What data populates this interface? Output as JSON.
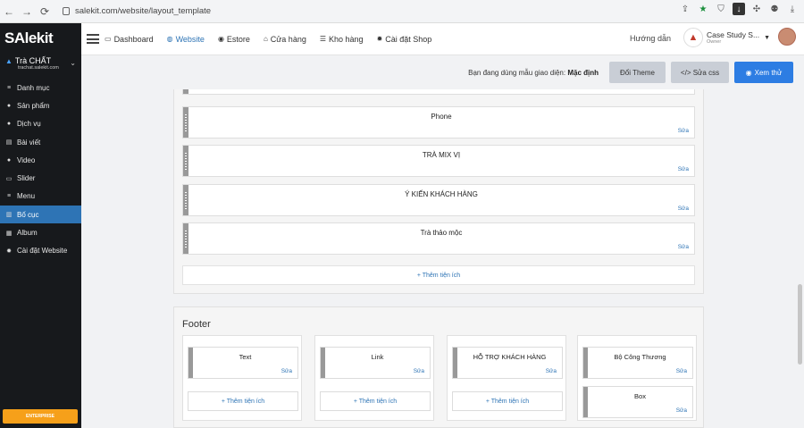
{
  "browser": {
    "url": "salekit.com/website/layout_template"
  },
  "sidebar": {
    "logo": "SAlekit",
    "shop_name": "Trà CHẤT",
    "shop_domain": "trachat.salekit.com",
    "items": [
      {
        "label": "Danh mục",
        "icon": "list-icon"
      },
      {
        "label": "Sản phẩm",
        "icon": "product-icon"
      },
      {
        "label": "Dịch vụ",
        "icon": "service-icon"
      },
      {
        "label": "Bài viết",
        "icon": "article-icon"
      },
      {
        "label": "Video",
        "icon": "video-icon"
      },
      {
        "label": "Slider",
        "icon": "slider-icon"
      },
      {
        "label": "Menu",
        "icon": "menu-icon"
      },
      {
        "label": "Bố cục",
        "icon": "layout-icon",
        "active": true
      },
      {
        "label": "Album",
        "icon": "album-icon"
      },
      {
        "label": "Cài đặt Website",
        "icon": "gear-icon"
      }
    ],
    "upgrade_label": "ENTERPRISE"
  },
  "topnav": {
    "items": [
      {
        "label": "Dashboard",
        "icon": "monitor-icon"
      },
      {
        "label": "Website",
        "icon": "globe-icon",
        "active": true
      },
      {
        "label": "Estore",
        "icon": "compass-icon"
      },
      {
        "label": "Cửa hàng",
        "icon": "store-icon"
      },
      {
        "label": "Kho hàng",
        "icon": "stack-icon"
      },
      {
        "label": "Cài đặt Shop",
        "icon": "gear-icon"
      }
    ],
    "guide": "Hướng dẫn",
    "account_name": "Case Study S...",
    "account_role": "Owner"
  },
  "toolbar": {
    "template_prefix": "Bạn đang dùng mẫu giao diện:",
    "template_name": "Mặc định",
    "change_theme": "Đổi Theme",
    "edit_css": "</> Sửa css",
    "preview": "Xem thử"
  },
  "body_widgets": [
    {
      "title": "Phone",
      "edit": "Sửa"
    },
    {
      "title": "TRÀ MIX VỊ",
      "edit": "Sửa"
    },
    {
      "title": "Ý KIẾN KHÁCH HÀNG",
      "edit": "Sửa"
    },
    {
      "title": "Trà thảo mộc",
      "edit": "Sửa"
    }
  ],
  "add_widget": "+ Thêm tiện ích",
  "footer": {
    "title": "Footer",
    "columns": [
      {
        "widgets": [
          {
            "title": "Text",
            "edit": "Sửa"
          }
        ],
        "add": "+ Thêm tiện ích"
      },
      {
        "widgets": [
          {
            "title": "Link",
            "edit": "Sửa"
          }
        ],
        "add": "+ Thêm tiện ích"
      },
      {
        "widgets": [
          {
            "title": "HỖ TRỢ KHÁCH HÀNG",
            "edit": "Sửa"
          }
        ],
        "add": "+ Thêm tiện ích"
      },
      {
        "widgets": [
          {
            "title": "Bộ Công Thương",
            "edit": "Sửa"
          },
          {
            "title": "Box",
            "edit": "Sửa"
          }
        ]
      }
    ]
  },
  "colors": {
    "accent": "#2e74b5",
    "sidebar_bg": "#17191c",
    "preview_btn": "#2d7de3",
    "upgrade_btn": "#f6a01a"
  }
}
